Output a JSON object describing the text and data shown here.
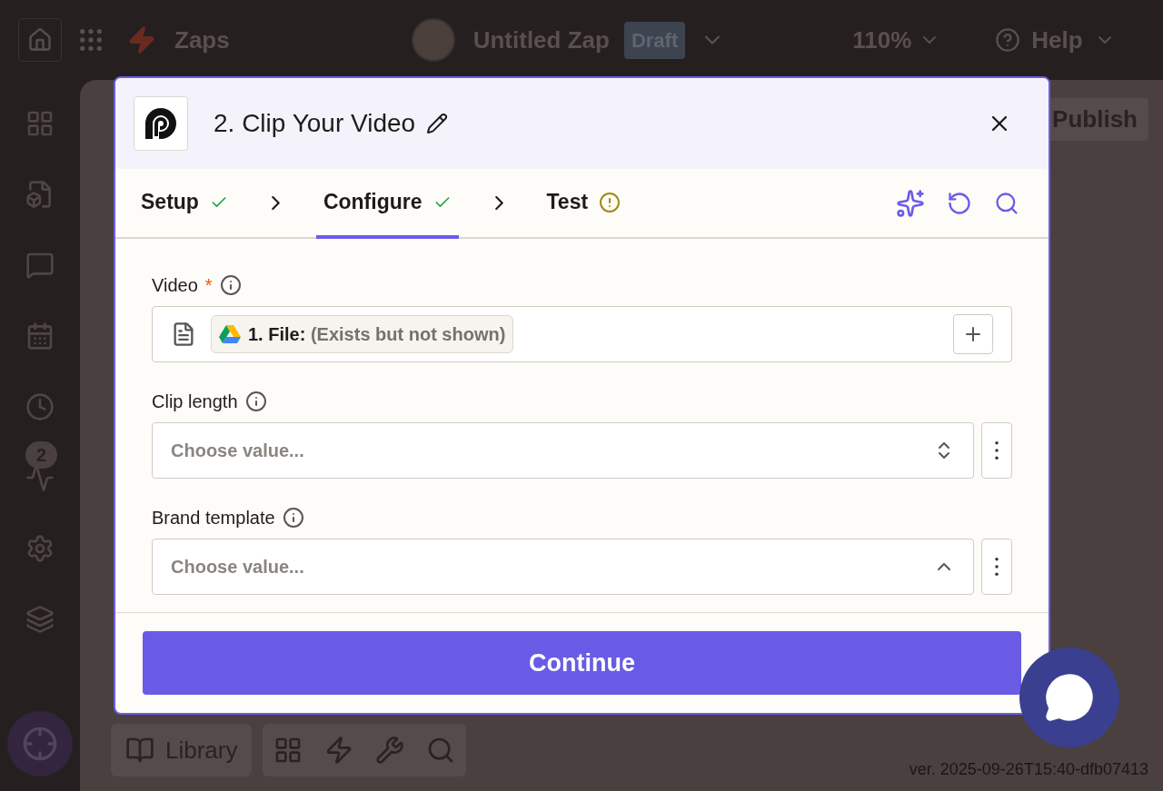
{
  "top_bar": {
    "app_name": "Zaps",
    "zap_title": "Untitled Zap",
    "status_badge": "Draft",
    "zoom": "110%",
    "help": "Help"
  },
  "sidebar": {
    "activity_badge": "2"
  },
  "canvas": {
    "publish_button": "Publish",
    "library_button": "Library",
    "version": "ver. 2025-09-26T15:40-dfb07413"
  },
  "modal": {
    "step_title": "2. Clip Your Video",
    "tabs": [
      {
        "label": "Setup",
        "done": true,
        "warning": false,
        "selected": false
      },
      {
        "label": "Configure",
        "done": true,
        "warning": false,
        "selected": true
      },
      {
        "label": "Test",
        "done": false,
        "warning": true,
        "selected": false
      }
    ],
    "fields": [
      {
        "kind": "mapped",
        "label": "Video",
        "required_mark": "*",
        "token": {
          "label": "1. File:",
          "value": "(Exists but not shown)"
        }
      },
      {
        "kind": "select",
        "label": "Clip length",
        "placeholder": "Choose value...",
        "expanded": false
      },
      {
        "kind": "select",
        "label": "Brand template",
        "placeholder": "Choose value...",
        "expanded": true
      }
    ],
    "continue_button": "Continue"
  }
}
